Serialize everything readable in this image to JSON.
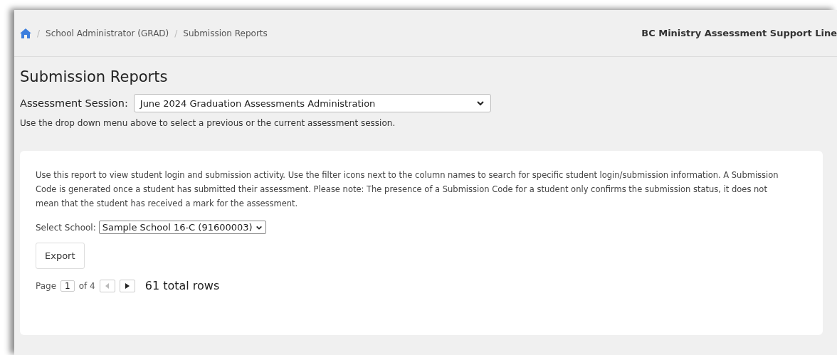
{
  "breadcrumb": [
    {
      "separator": "/",
      "label": "School Administrator (GRAD)"
    },
    {
      "separator": "/",
      "label": "Submission Reports"
    }
  ],
  "support_line": "BC Ministry Assessment Support Line",
  "title": "Submission Reports",
  "session": {
    "label": "Assessment Session:",
    "value": "June 2024 Graduation Assessments Administration",
    "help": "Use the drop down menu above to select a previous or the current assessment session."
  },
  "report": {
    "description": "Use this report to view student login and submission activity. Use the filter icons next to the column names to search for specific student login/submission information. A Submission Code is generated once a student has submitted their assessment. Please note: The presence of a Submission Code for a student only confirms the submission status, it does not mean that the student has received a mark for the assessment.",
    "school": {
      "label": "Select School:",
      "value": "Sample School 16-C (91600003)"
    },
    "export_button": "Export",
    "pager": {
      "page_label": "Page",
      "page": "1",
      "of_label": "of 4",
      "prev_disabled": true,
      "next_disabled": false,
      "total": "61 total rows"
    }
  }
}
